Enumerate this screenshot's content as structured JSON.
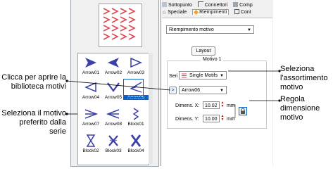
{
  "callouts": {
    "apri_biblioteca": "Clicca per aprire la biblioteca motivi",
    "seleziona_motivo": "Seleziona il motivo preferito dalla serie",
    "seleziona_assortimento": "Seleziona l'assortimento motivo",
    "regola_dimensione": "Regola dimensione motivo"
  },
  "tabs_row1": [
    {
      "label": "Sottopunto",
      "icon": "underlay-icon"
    },
    {
      "label": "Connettori",
      "icon": "connector-icon"
    },
    {
      "label": "Comp",
      "icon": "compensation-icon"
    }
  ],
  "tabs_row2": [
    {
      "label": "Speciale",
      "icon": "star-icon"
    },
    {
      "label": "Riempimenti",
      "icon": "fill-icon",
      "active": true
    },
    {
      "label": "Cont",
      "icon": "outline-icon"
    }
  ],
  "fill_type": {
    "value": "Riempimento motivo"
  },
  "layout_button": "Layout",
  "motif_group": {
    "title": "Motivo 1",
    "set_label": "Seri",
    "set_value": "Single Motifs",
    "motif_value": "Arrow06",
    "open_library_button": ">",
    "size_x_label": "Dimens. X:",
    "size_x_value": "10.02",
    "size_y_label": "Dimens. Y:",
    "size_y_value": "10.00",
    "unit": "mm"
  },
  "motifs": [
    {
      "label": "Arrow01",
      "icon": "arrow-right-filled-icon"
    },
    {
      "label": "Arrow02",
      "icon": "arrow-left-filled-icon"
    },
    {
      "label": "Arrow03",
      "icon": "arrow-right-outline-icon"
    },
    {
      "label": "Arrow04",
      "icon": "arrow-left-outline-icon"
    },
    {
      "label": "Arrow05",
      "icon": "arrow-down-icon"
    },
    {
      "label": "Arrow06",
      "icon": "arrow-left-open-icon",
      "selected": true
    },
    {
      "label": "Arrow07",
      "icon": "arrow-right-line-icon"
    },
    {
      "label": "Arrow08",
      "icon": "arrow-left-line-icon"
    },
    {
      "label": "Block01",
      "icon": "block-zigzag-icon"
    },
    {
      "label": "Block02",
      "icon": "block-hourglass-icon"
    },
    {
      "label": "Block03",
      "icon": "block-cross-icon"
    },
    {
      "label": "Block04",
      "icon": "block-bowtie-icon"
    }
  ],
  "colors": {
    "accent": "#0a62c9",
    "motif": "#3b3fa8",
    "preview_pattern": "#e0464f"
  }
}
